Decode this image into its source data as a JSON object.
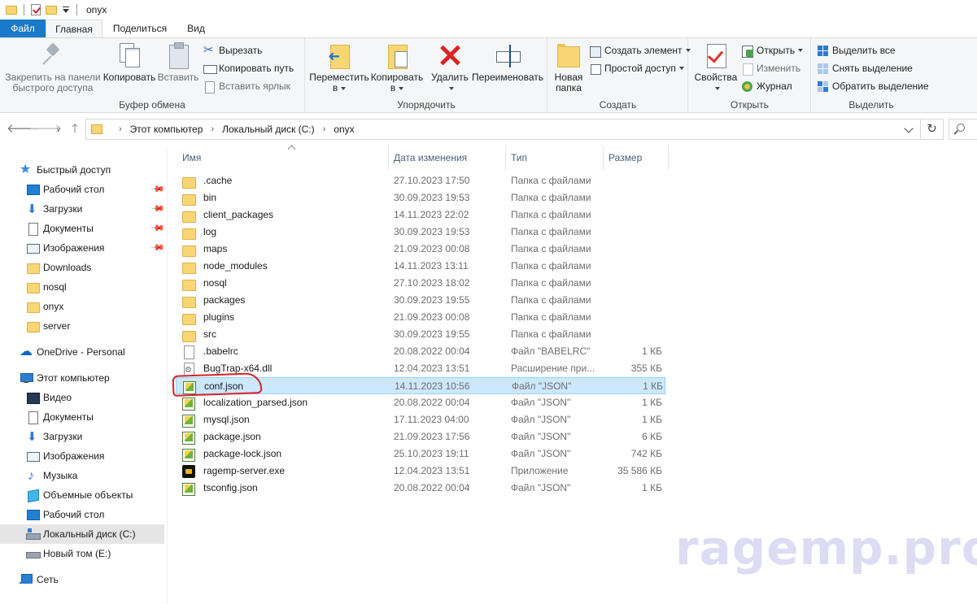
{
  "window": {
    "title": "onyx"
  },
  "tabs": {
    "file": "Файл",
    "home": "Главная",
    "share": "Поделиться",
    "view": "Вид"
  },
  "ribbon": {
    "clipboard": {
      "label": "Буфер обмена",
      "pin_line1": "Закрепить на панели",
      "pin_line2": "быстрого доступа",
      "copy": "Копировать",
      "paste": "Вставить",
      "cut": "Вырезать",
      "copy_path": "Копировать путь",
      "paste_shortcut": "Вставить ярлык"
    },
    "organize": {
      "label": "Упорядочить",
      "move_line1": "Переместить",
      "move_line2": "в",
      "copyto_line1": "Копировать",
      "copyto_line2": "в",
      "delete": "Удалить",
      "rename": "Переименовать"
    },
    "create": {
      "label": "Создать",
      "new_folder_line1": "Новая",
      "new_folder_line2": "папка",
      "new_item": "Создать элемент",
      "easy_access": "Простой доступ"
    },
    "open": {
      "label": "Открыть",
      "properties": "Свойства",
      "open": "Открыть",
      "edit": "Изменить",
      "history": "Журнал"
    },
    "select": {
      "label": "Выделить",
      "select_all": "Выделить все",
      "select_none": "Снять выделение",
      "invert": "Обратить выделение"
    }
  },
  "address": {
    "crumbs": [
      "Этот компьютер",
      "Локальный диск (C:)",
      "onyx"
    ]
  },
  "nav": {
    "quick_access": "Быстрый доступ",
    "qa_items": [
      "Рабочий стол",
      "Загрузки",
      "Документы",
      "Изображения",
      "Downloads",
      "nosql",
      "onyx",
      "server"
    ],
    "onedrive": "OneDrive - Personal",
    "this_pc": "Этот компьютер",
    "pc_items": [
      "Видео",
      "Документы",
      "Загрузки",
      "Изображения",
      "Музыка",
      "Объемные объекты",
      "Рабочий стол",
      "Локальный диск (C:)",
      "Новый том (E:)"
    ],
    "network": "Сеть"
  },
  "columns": {
    "name": "Имя",
    "date": "Дата изменения",
    "type": "Тип",
    "size": "Размер"
  },
  "files": [
    {
      "name": ".cache",
      "date": "27.10.2023 17:50",
      "type": "Папка с файлами",
      "size": "",
      "icon": "folder-icon"
    },
    {
      "name": "bin",
      "date": "30.09.2023 19:53",
      "type": "Папка с файлами",
      "size": "",
      "icon": "folder-icon"
    },
    {
      "name": "client_packages",
      "date": "14.11.2023 22:02",
      "type": "Папка с файлами",
      "size": "",
      "icon": "folder-icon"
    },
    {
      "name": "log",
      "date": "30.09.2023 19:53",
      "type": "Папка с файлами",
      "size": "",
      "icon": "folder-icon"
    },
    {
      "name": "maps",
      "date": "21.09.2023 00:08",
      "type": "Папка с файлами",
      "size": "",
      "icon": "folder-icon"
    },
    {
      "name": "node_modules",
      "date": "14.11.2023 13:11",
      "type": "Папка с файлами",
      "size": "",
      "icon": "folder-icon"
    },
    {
      "name": "nosql",
      "date": "27.10.2023 18:02",
      "type": "Папка с файлами",
      "size": "",
      "icon": "folder-icon"
    },
    {
      "name": "packages",
      "date": "30.09.2023 19:55",
      "type": "Папка с файлами",
      "size": "",
      "icon": "folder-icon"
    },
    {
      "name": "plugins",
      "date": "21.09.2023 00:08",
      "type": "Папка с файлами",
      "size": "",
      "icon": "folder-icon"
    },
    {
      "name": "src",
      "date": "30.09.2023 19:55",
      "type": "Папка с файлами",
      "size": "",
      "icon": "folder-icon"
    },
    {
      "name": ".babelrc",
      "date": "20.08.2022 00:04",
      "type": "Файл \"BABELRC\"",
      "size": "1 КБ",
      "icon": "file-icon"
    },
    {
      "name": "BugTrap-x64.dll",
      "date": "12.04.2023 13:51",
      "type": "Расширение при...",
      "size": "355 КБ",
      "icon": "dll-icon"
    },
    {
      "name": "conf.json",
      "date": "14.11.2023 10:56",
      "type": "Файл \"JSON\"",
      "size": "1 КБ",
      "icon": "json-icon"
    },
    {
      "name": "localization_parsed.json",
      "date": "20.08.2022 00:04",
      "type": "Файл \"JSON\"",
      "size": "1 КБ",
      "icon": "json-icon"
    },
    {
      "name": "mysql.json",
      "date": "17.11.2023 04:00",
      "type": "Файл \"JSON\"",
      "size": "1 КБ",
      "icon": "json-icon"
    },
    {
      "name": "package.json",
      "date": "21.09.2023 17:56",
      "type": "Файл \"JSON\"",
      "size": "6 КБ",
      "icon": "json-icon"
    },
    {
      "name": "package-lock.json",
      "date": "25.10.2023 19:11",
      "type": "Файл \"JSON\"",
      "size": "742 КБ",
      "icon": "json-icon"
    },
    {
      "name": "ragemp-server.exe",
      "date": "12.04.2023 13:51",
      "type": "Приложение",
      "size": "35 586 КБ",
      "icon": "exe-icon"
    },
    {
      "name": "tsconfig.json",
      "date": "20.08.2022 00:04",
      "type": "Файл \"JSON\"",
      "size": "1 КБ",
      "icon": "json-icon"
    }
  ],
  "selected_file": "conf.json",
  "watermark": "ragemp.pro",
  "colors": {
    "accent": "#1979ca",
    "selection": "#cce8ff",
    "annotation": "#d8212a"
  }
}
